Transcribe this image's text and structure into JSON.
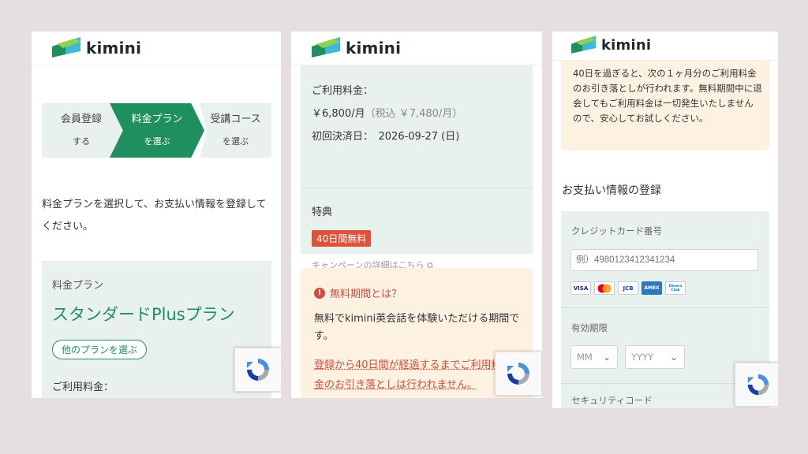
{
  "brand": {
    "name": "kimini"
  },
  "panel1": {
    "steps": [
      {
        "line1": "会員登録",
        "line2": "する",
        "active": false
      },
      {
        "line1": "料金プラン",
        "line2": "を選ぶ",
        "active": true
      },
      {
        "line1": "受講コース",
        "line2": "を選ぶ",
        "active": false
      }
    ],
    "description": "料金プランを選択して、お支払い情報を登録してください。",
    "plan": {
      "label": "料金プラン",
      "name": "スタンダードPlusプラン",
      "change_button": "他のプランを選ぶ",
      "fee_label": "ご利用料金："
    }
  },
  "panel2": {
    "fee_label": "ご利用料金：",
    "price": "￥6,800/月",
    "price_tax": "（税込 ￥7,480/月）",
    "first_payment": "初回決済日：　2026-09-27 (日)",
    "benefit_label": "特典",
    "badge": "40日間無料",
    "campaign_link": "キャンペーンの詳細はこちら",
    "warning": {
      "title": "無料期間とは？",
      "body": "無料でkimini英会話を体験いただける期間です。",
      "note": "登録から40日間が経過するまでご利用料金のお引き落としは行われません。"
    }
  },
  "panel3": {
    "notice": "40日を過ぎると、次の１ヶ月分のご利用料金のお引き落としが行われます。無料期間中に退会してもご利用料金は一切発生いたしませんので、安心してお試しください。",
    "section_title": "お支払い情報の登録",
    "card_number_label": "クレジットカード番号",
    "card_number_placeholder": "例）4980123412341234",
    "card_brands": [
      "VISA",
      "MC",
      "JCB",
      "AMEX",
      "Diners Club"
    ],
    "expiry_label": "有効期限",
    "expiry_month": "MM",
    "expiry_year": "YYYY",
    "security_label": "セキュリティコード"
  },
  "colors": {
    "brand_green": "#1f8f5f",
    "mint_bg": "#e9f1ef",
    "warning_bg": "#fdf2e2",
    "alert_red": "#d34b3b"
  }
}
